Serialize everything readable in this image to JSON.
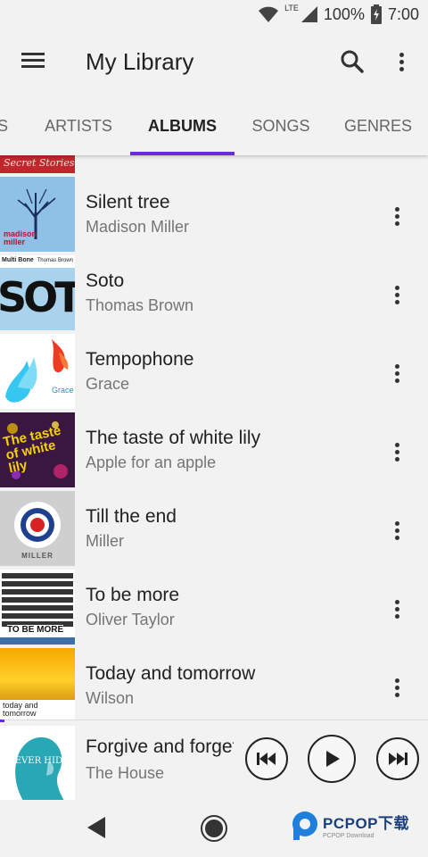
{
  "status_bar": {
    "network": "LTE",
    "battery": "100%",
    "time": "7:00"
  },
  "header": {
    "title": "My Library"
  },
  "tabs": [
    {
      "label": "S"
    },
    {
      "label": "ARTISTS"
    },
    {
      "label": "ALBUMS"
    },
    {
      "label": "SONGS"
    },
    {
      "label": "GENRES"
    }
  ],
  "active_tab": "ALBUMS",
  "albums": [
    {
      "cover_text": "Secret Stories"
    },
    {
      "title": "Silent tree",
      "artist": "Madison Miller",
      "cover_text": "madison miller"
    },
    {
      "title": "Soto",
      "artist": "Thomas Brown",
      "cover_text": "SOTO",
      "cover_caption_left": "Multi Bone",
      "cover_caption_right": "Thomas Brown"
    },
    {
      "title": "Tempophone",
      "artist": "Grace",
      "cover_text": "Grace"
    },
    {
      "title": "The taste of white lily",
      "artist": "Apple for an apple",
      "cover_text": "The taste of white lily"
    },
    {
      "title": "Till the end",
      "artist": "Miller",
      "cover_text": "MILLER"
    },
    {
      "title": "To be more",
      "artist": "Oliver Taylor",
      "cover_text": "TO BE MORE"
    },
    {
      "title": "Today and tomorrow",
      "artist": "Wilson",
      "cover_text": "today and tomorrow"
    }
  ],
  "now_playing": {
    "title": "Forgive and forget",
    "artist": "The House",
    "cover_text": "NEVER HIDE",
    "progress": 0.01
  },
  "watermark": {
    "brand": "PCPOP下载",
    "sub": "PCPOP Download"
  },
  "colors": {
    "accent": "#6a2cd8",
    "background": "#f2f2f2"
  }
}
